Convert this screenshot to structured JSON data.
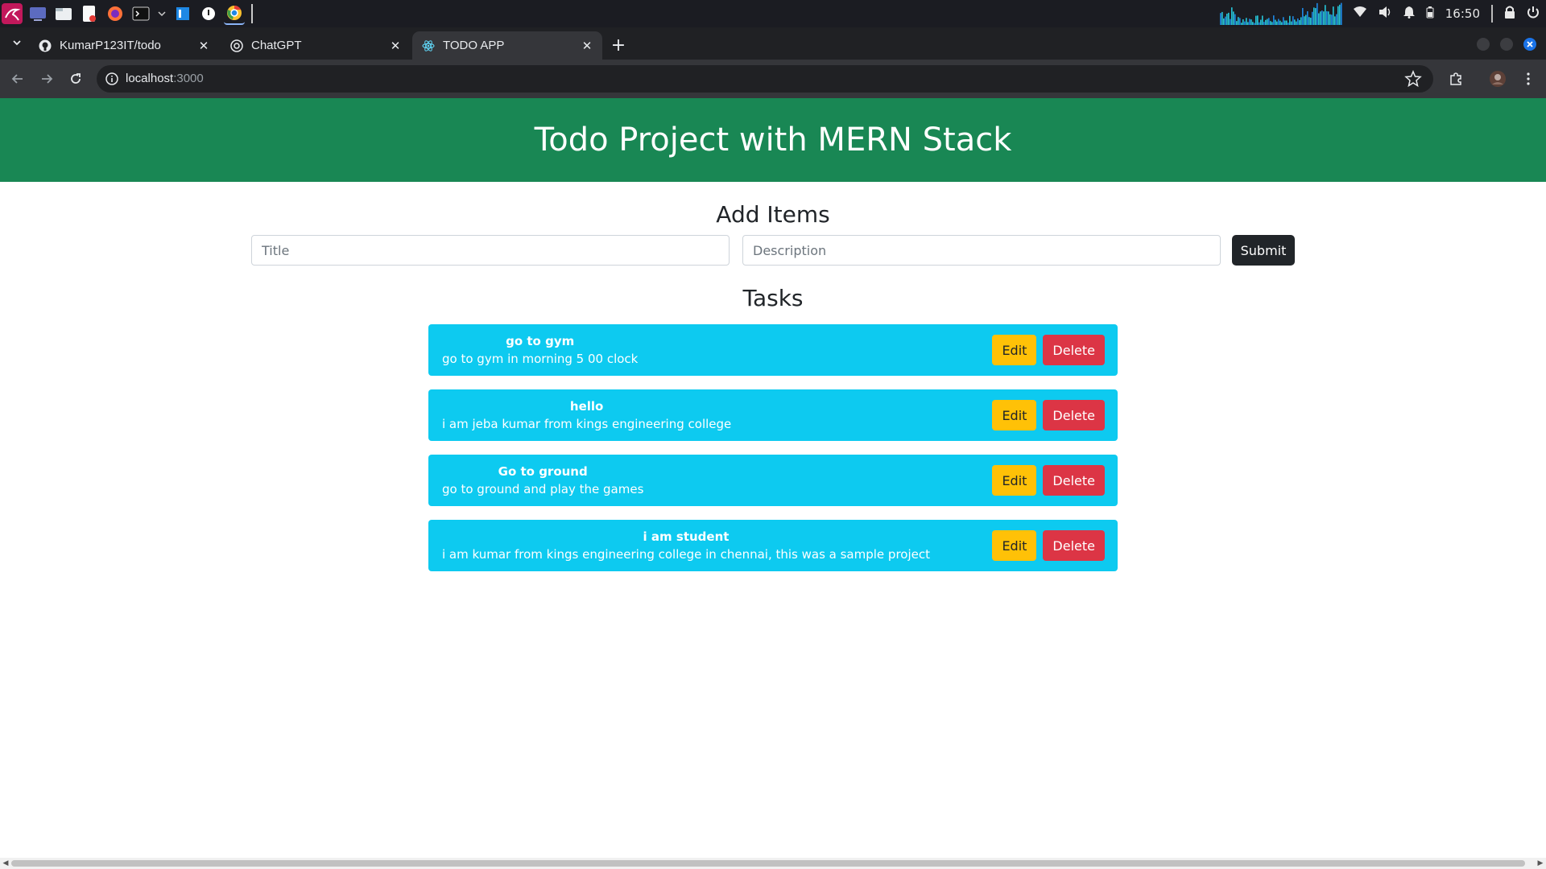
{
  "os_panel": {
    "launcher_icons": [
      "kali-menu-icon",
      "desktop-icon",
      "file-manager-icon",
      "text-editor-icon",
      "firefox-icon",
      "terminal-icon",
      "chevron-down-icon",
      "code-editor-icon",
      "onlyoffice-icon",
      "chrome-icon"
    ],
    "clock": "16:50",
    "tray_icons": [
      "cpu-graph",
      "wifi-icon",
      "volume-icon",
      "bell-icon",
      "battery-icon",
      "lock-icon",
      "power-icon"
    ]
  },
  "browser": {
    "tabs": [
      {
        "title": "KumarP123IT/todo",
        "icon": "github-icon",
        "active": false
      },
      {
        "title": "ChatGPT",
        "icon": "chatgpt-icon",
        "active": false
      },
      {
        "title": "TODO APP",
        "icon": "react-icon",
        "active": true
      }
    ],
    "url_host": "localhost",
    "url_port": ":3000"
  },
  "page": {
    "header_title": "Todo Project with MERN Stack",
    "add_heading": "Add Items",
    "title_placeholder": "Title",
    "description_placeholder": "Description",
    "submit_label": "Submit",
    "tasks_heading": "Tasks",
    "edit_label": "Edit",
    "delete_label": "Delete",
    "tasks": [
      {
        "title": "go to gym",
        "description": "go to gym in morning 5 00 clock"
      },
      {
        "title": "hello",
        "description": "i am jeba kumar from kings engineering college"
      },
      {
        "title": "Go to ground",
        "description": "go to ground and play the games"
      },
      {
        "title": "i am student",
        "description": "i am kumar from kings engineering college in chennai, this was a sample project"
      }
    ]
  },
  "colors": {
    "header_bg": "#198754",
    "task_bg": "#0dcaf0",
    "edit_bg": "#ffc107",
    "delete_bg": "#dc3545",
    "submit_bg": "#212529"
  }
}
